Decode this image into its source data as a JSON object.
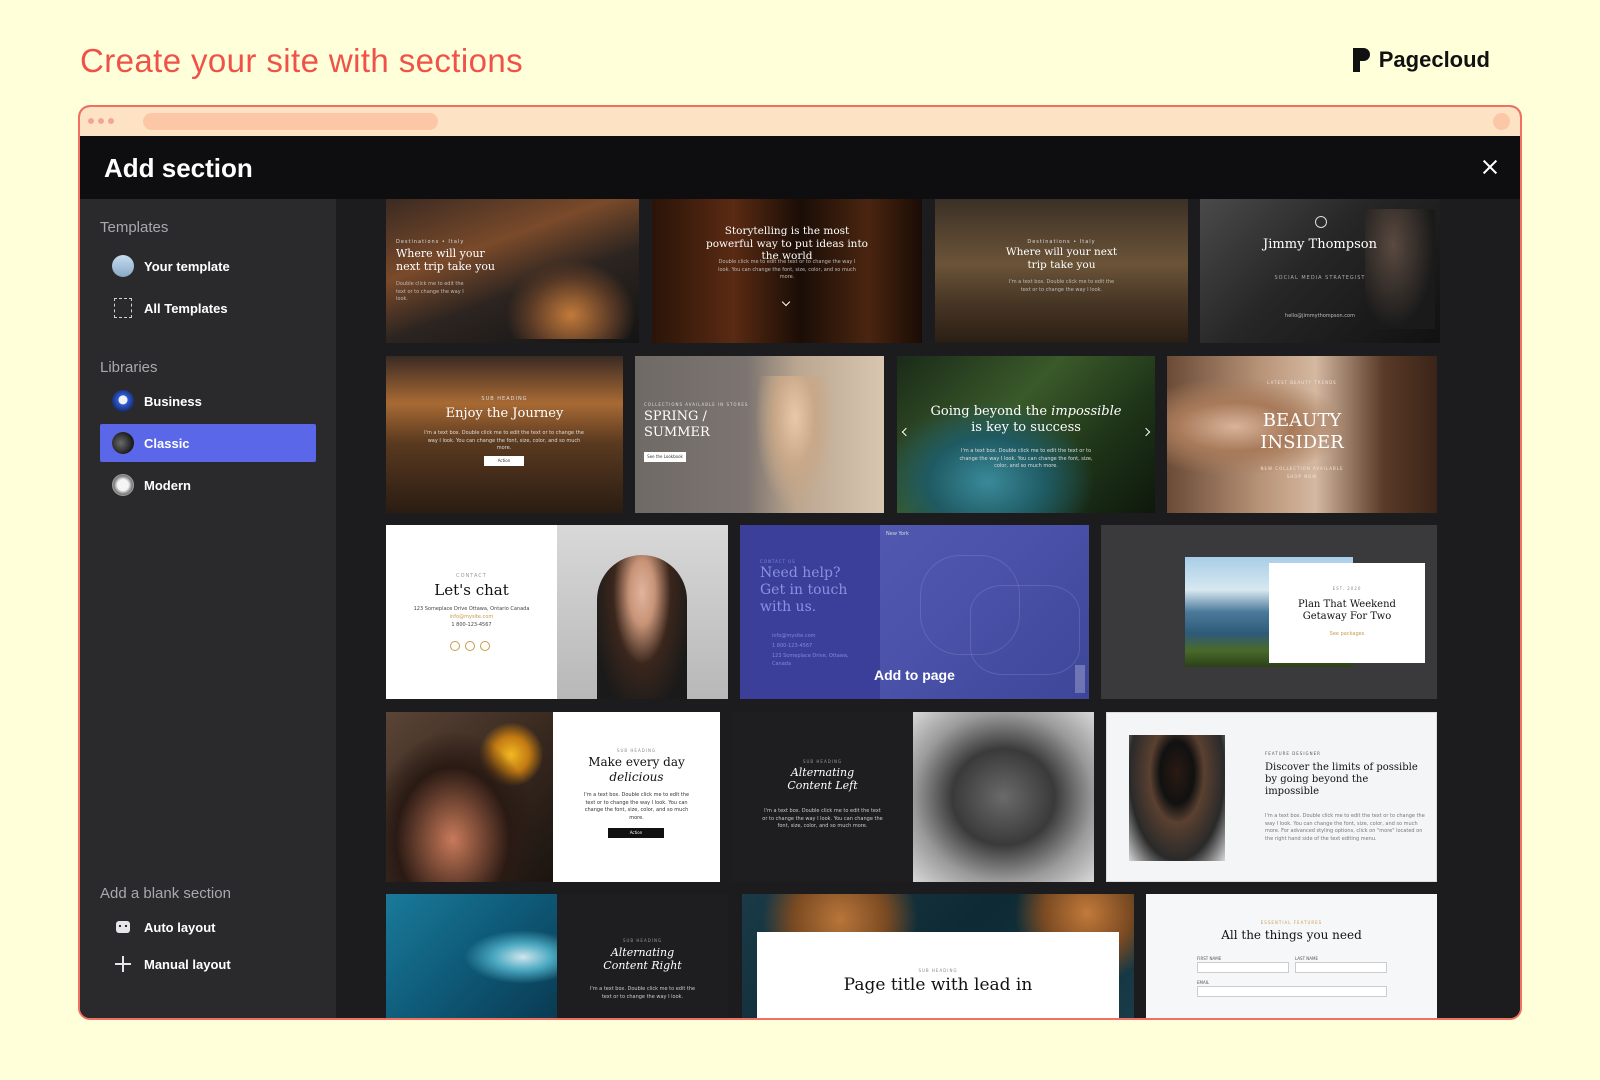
{
  "header": {
    "title": "Create your site with sections",
    "brand": "Pagecloud"
  },
  "modal": {
    "title": "Add section",
    "close_icon": "close-icon"
  },
  "sidebar": {
    "templates_heading": "Templates",
    "your_template": "Your template",
    "all_templates": "All Templates",
    "libraries_heading": "Libraries",
    "business": "Business",
    "classic": "Classic",
    "modern": "Modern",
    "blank_heading": "Add a blank section",
    "auto_layout": "Auto layout",
    "manual_layout": "Manual layout"
  },
  "cards": {
    "c1": {
      "kicker": "Destinations • Italy",
      "title": "Where will your next trip take you",
      "body": "Double click me to edit the text or to change the way I look."
    },
    "c2": {
      "title": "Storytelling is the most powerful way to put ideas into the world",
      "body": "Double click me to edit the text or to change the way I look. You can change the font, size, color, and so much more."
    },
    "c3": {
      "kicker": "Destinations • Italy",
      "title": "Where will your next trip take you",
      "body": "I'm a text box. Double click me to edit the text or to change the way I look."
    },
    "c4": {
      "title": "Jimmy Thompson",
      "sub": "SOCIAL MEDIA STRATEGIST",
      "body": "hello@jimmythompson.com"
    },
    "c5": {
      "kicker": "SUB HEADING",
      "title": "Enjoy the Journey",
      "body": "I'm a text box. Double click me to edit the text or to change the way I look. You can change the font, size, color, and so much more.",
      "button": "Action"
    },
    "c6": {
      "kicker": "COLLECTIONS AVAILABLE IN STORES",
      "title": "SPRING / SUMMER",
      "button": "See the Lookbook"
    },
    "c7": {
      "title_a": "Going beyond the ",
      "title_em": "impossible",
      "title_b": "is key to success",
      "body": "I'm a text box. Double click me to edit the text or to change the way I look. You can change the font, size, color, and so much more."
    },
    "c8": {
      "kicker": "LATEST BEAUTY TRENDS",
      "title": "BEAUTY INSIDER",
      "sub": "NEW COLLECTION AVAILABLE",
      "link": "SHOP NOW"
    },
    "c9": {
      "kicker": "CONTACT",
      "title": "Let's chat",
      "address": "123 Someplace Drive Ottawa, Ontario Canada",
      "email": "info@mysite.com",
      "phone": "1 800-123-4567"
    },
    "c10": {
      "kicker": "CONTACT US",
      "title": "Need help? Get in touch with us.",
      "email": "info@mysite.com",
      "phone": "1 800-123-4567",
      "address": "123 Someplace Drive, Ottawa, Canada",
      "map_city": "New York",
      "add_label": "Add to page"
    },
    "c11": {
      "kicker": "EST. 2020",
      "title": "Plan That Weekend Getaway For Two",
      "link": "See packages"
    },
    "c12": {
      "kicker": "SUB HEADING",
      "title": "Make every day",
      "title_em": "delicious",
      "body": "I'm a text box. Double click me to edit the text or to change the way I look. You can change the font, size, color, and so much more.",
      "button": "Action"
    },
    "c13": {
      "kicker": "SUB HEADING",
      "title": "Alternating Content Left",
      "body": "I'm a text box. Double click me to edit the text or to change the way I look. You can change the font, size, color, and so much more."
    },
    "c14": {
      "kicker": "FEATURE DESIGNER",
      "title": "Discover the limits of possible by going beyond the impossible",
      "body": "I'm a text box. Double click me to edit the text or to change the way I look. You can change the font, size, color, and so much more. For advanced styling options, click on \"more\" located on the right hand side of the text editing menu."
    },
    "c15": {
      "kicker": "SUB HEADING",
      "title": "Alternating Content Right",
      "body": "I'm a text box. Double click me to edit the text or to change the way I look."
    },
    "c16": {
      "kicker": "SUB HEADING",
      "title": "Page title with lead in"
    },
    "c17": {
      "kicker": "ESSENTIAL FEATURES",
      "title": "All the things you need",
      "first_name": "FIRST NAME",
      "last_name": "LAST NAME",
      "email": "EMAIL"
    }
  },
  "colors": {
    "accent": "#5a67e8",
    "title_red": "#f0524a",
    "cursor": "#f0524a"
  }
}
